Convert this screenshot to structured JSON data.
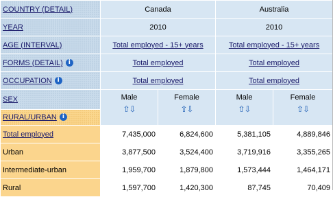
{
  "dimensions": {
    "country": "COUNTRY (DETAIL)",
    "year": "YEAR",
    "age": "AGE (INTERVAL)",
    "forms": "FORMS (DETAIL)",
    "occupation": "OCCUPATION",
    "sex": "SEX",
    "rural_urban": "RURAL/URBAN"
  },
  "countries": [
    "Canada",
    "Australia"
  ],
  "year_value": "2010",
  "age_value": "Total employed - 15+ years",
  "forms_value": "Total employed",
  "occupation_value": "Total employed",
  "sex_values": [
    "Male",
    "Female",
    "Male",
    "Female"
  ],
  "icons": {
    "info": "info-icon",
    "sort": "sort-arrows-icon"
  },
  "info_glyph": "i",
  "sort_glyph": "⇧⇩",
  "rows": [
    {
      "label": "Total employed",
      "values": [
        "7,435,000",
        "6,824,600",
        "5,381,105",
        "4,889,846"
      ]
    },
    {
      "label": "Urban",
      "values": [
        "3,877,500",
        "3,524,400",
        "3,719,916",
        "3,355,265"
      ]
    },
    {
      "label": "Intermediate-urban",
      "values": [
        "1,959,700",
        "1,879,800",
        "1,573,444",
        "1,464,171"
      ]
    },
    {
      "label": "Rural",
      "values": [
        "1,597,700",
        "1,420,300",
        "87,745",
        "70,409"
      ]
    }
  ],
  "colors": {
    "header_blue": "#c9dbeb",
    "header_orange": "#fbd58d",
    "link": "#1a1a6a",
    "icon_blue": "#1f64c4"
  }
}
